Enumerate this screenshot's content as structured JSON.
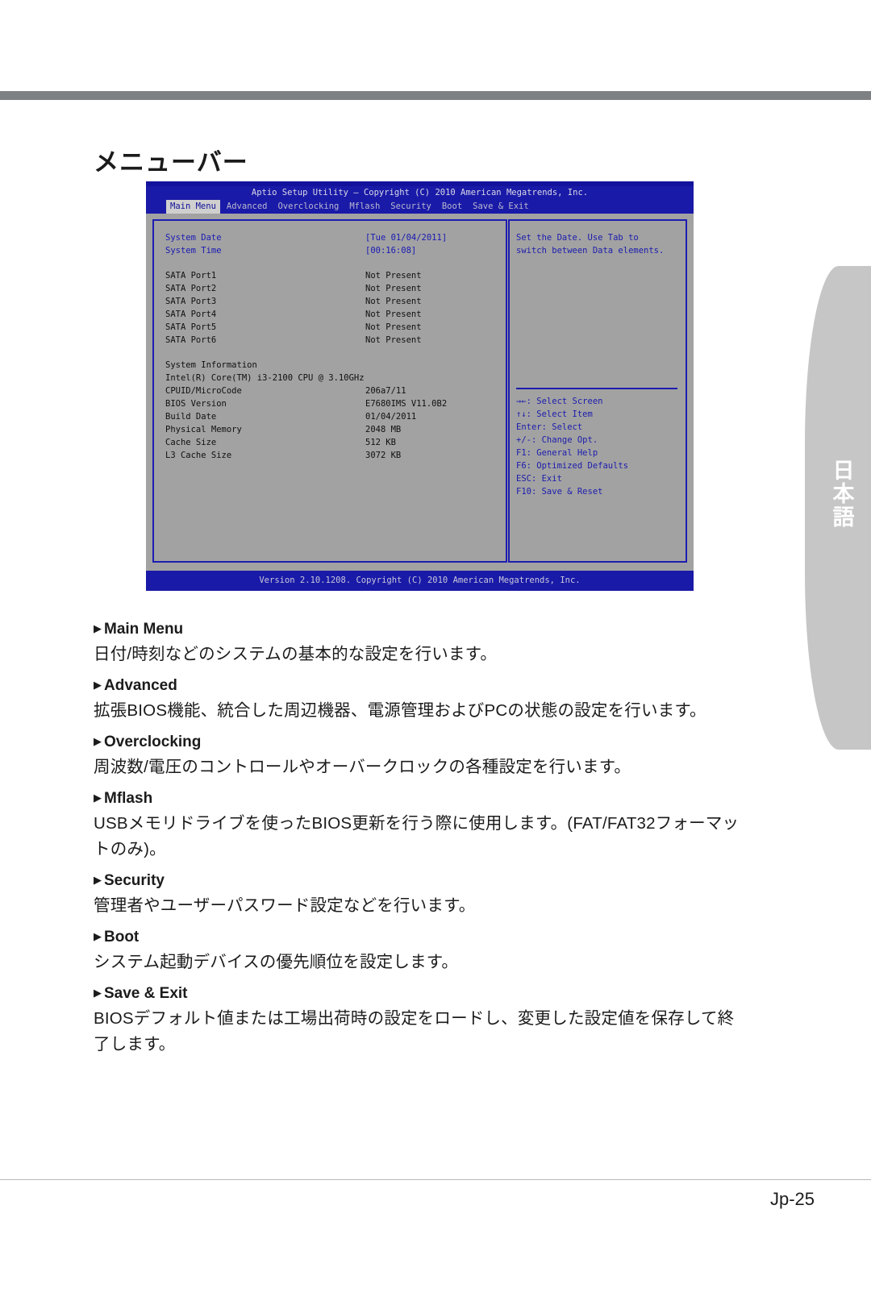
{
  "page": {
    "title": "メニューバー",
    "side_tab": "日本語",
    "page_number": "Jp-25"
  },
  "bios": {
    "header": "Aptio Setup Utility – Copyright (C) 2010 American Megatrends, Inc.",
    "tabs": [
      {
        "label": "Main Menu",
        "active": true
      },
      {
        "label": "Advanced",
        "active": false
      },
      {
        "label": "Overclocking",
        "active": false
      },
      {
        "label": "Mflash",
        "active": false
      },
      {
        "label": "Security",
        "active": false
      },
      {
        "label": "Boot",
        "active": false
      },
      {
        "label": "Save & Exit",
        "active": false
      }
    ],
    "datetime_rows": [
      {
        "key": "System Date",
        "value": "[Tue 01/04/2011]"
      },
      {
        "key": "System Time",
        "value": "[00:16:08]"
      }
    ],
    "sata_rows": [
      {
        "key": "SATA Port1",
        "value": "Not Present"
      },
      {
        "key": "SATA Port2",
        "value": "Not Present"
      },
      {
        "key": "SATA Port3",
        "value": "Not Present"
      },
      {
        "key": "SATA Port4",
        "value": "Not Present"
      },
      {
        "key": "SATA Port5",
        "value": "Not Present"
      },
      {
        "key": "SATA Port6",
        "value": "Not Present"
      }
    ],
    "sysinfo_title": "System Information",
    "cpu_name": "Intel(R) Core(TM) i3-2100 CPU @ 3.10GHz",
    "sysinfo_rows": [
      {
        "key": "CPUID/MicroCode",
        "value": "206a7/11"
      },
      {
        "key": "BIOS Version",
        "value": "E7680IMS V11.0B2"
      },
      {
        "key": "Build Date",
        "value": "01/04/2011"
      },
      {
        "key": "Physical Memory",
        "value": "2048 MB"
      },
      {
        "key": "Cache Size",
        "value": "512 KB"
      },
      {
        "key": "L3 Cache Size",
        "value": "3072 KB"
      }
    ],
    "help_text": "Set the Date. Use Tab to\nswitch between Data elements.",
    "help_keys": "→←: Select Screen\n↑↓: Select Item\nEnter: Select\n+/-: Change Opt.\nF1: General Help\nF6: Optimized Defaults\nESC: Exit\nF10: Save & Reset",
    "footer": "Version 2.10.1208. Copyright (C) 2010 American Megatrends, Inc.",
    "colors": {
      "screen_bg": "#a2a2a2",
      "bar_blue": "#1a1aa8",
      "border_blue": "#1d1db0",
      "highlight_text": "#1919b4"
    }
  },
  "sections": [
    {
      "heading": "Main Menu",
      "body": "日付/時刻などのシステムの基本的な設定を行います。"
    },
    {
      "heading": "Advanced",
      "body": "拡張BIOS機能、統合した周辺機器、電源管理およびPCの状態の設定を行います。"
    },
    {
      "heading": "Overclocking",
      "body": "周波数/電圧のコントロールやオーバークロックの各種設定を行います。"
    },
    {
      "heading": "Mflash",
      "body": "USBメモリドライブを使ったBIOS更新を行う際に使用します。(FAT/FAT32フォーマットのみ)。"
    },
    {
      "heading": "Security",
      "body": "管理者やユーザーパスワード設定などを行います。"
    },
    {
      "heading": "Boot",
      "body": "システム起動デバイスの優先順位を設定します。"
    },
    {
      "heading": "Save & Exit",
      "body": "BIOSデフォルト値または工場出荷時の設定をロードし、変更した設定値を保存して終了します。"
    }
  ]
}
